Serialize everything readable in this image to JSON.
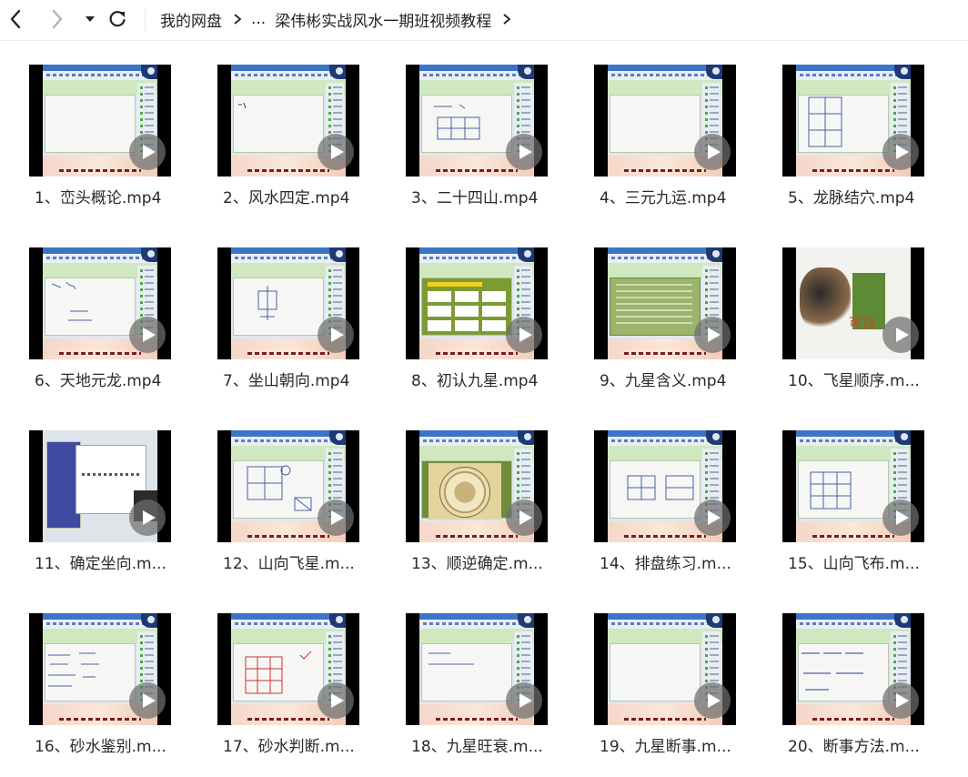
{
  "nav": {
    "back_icon": "chevron-left-icon",
    "forward_icon": "chevron-right-icon",
    "history_icon": "caret-down-icon",
    "refresh_icon": "refresh-icon"
  },
  "breadcrumb": {
    "root": "我的网盘",
    "ellipsis": "...",
    "current": "梁伟彬实战风水一期班视频教程"
  },
  "files": [
    {
      "name": "1、峦头概论.mp4"
    },
    {
      "name": "2、风水四定.mp4"
    },
    {
      "name": "3、二十四山.mp4"
    },
    {
      "name": "4、三元九运.mp4"
    },
    {
      "name": "5、龙脉结穴.mp4"
    },
    {
      "name": "6、天地元龙.mp4"
    },
    {
      "name": "7、坐山朝向.mp4"
    },
    {
      "name": "8、初认九星.mp4"
    },
    {
      "name": "9、九星含义.mp4"
    },
    {
      "name": "10、飞星顺序.m..."
    },
    {
      "name": "11、确定坐向.m..."
    },
    {
      "name": "12、山向飞星.m..."
    },
    {
      "name": "13、顺逆确定.m..."
    },
    {
      "name": "14、排盘练习.m..."
    },
    {
      "name": "15、山向飞布.m..."
    },
    {
      "name": "16、砂水鉴别.m..."
    },
    {
      "name": "17、砂水判断.m..."
    },
    {
      "name": "18、九星旺衰.m..."
    },
    {
      "name": "19、九星断事.m..."
    },
    {
      "name": "20、断事方法.m..."
    }
  ],
  "thumb_overlay_text": {
    "art": "可以"
  },
  "colors": {
    "play_overlay": "#6e6e6e",
    "divider": "#ececec"
  }
}
